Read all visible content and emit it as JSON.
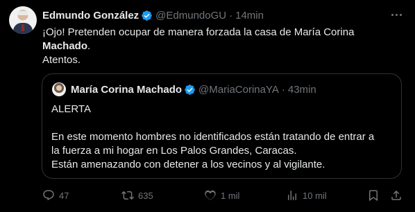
{
  "tweet": {
    "author_name": "Edmundo González",
    "author_handle": "@EdmundoGU",
    "separator": "·",
    "time": "14min",
    "text_line1": "¡Ojo! Pretenden ocupar de manera forzada la casa de María Corina",
    "text_line2_bold": "Machado",
    "text_line2_after": ".",
    "text_line3": "Atentos."
  },
  "quote": {
    "author_name": "María Corina Machado",
    "author_handle": "@MariaCorinaYA",
    "separator": "·",
    "time": "43min",
    "lines": [
      "ALERTA",
      "En este momento hombres no identificados están tratando de entrar a",
      "la fuerza a mi hogar en Los Palos Grandes, Caracas.",
      "Están amenazando con detener a los vecinos y al vigilante."
    ]
  },
  "actions": {
    "replies": "47",
    "reposts": "635",
    "likes": "1 mil",
    "views": "10 mil"
  },
  "colors": {
    "background": "#000000",
    "text": "#e7e9ea",
    "muted": "#71767b",
    "border": "#2f3336",
    "verified": "#1d9bf0"
  }
}
